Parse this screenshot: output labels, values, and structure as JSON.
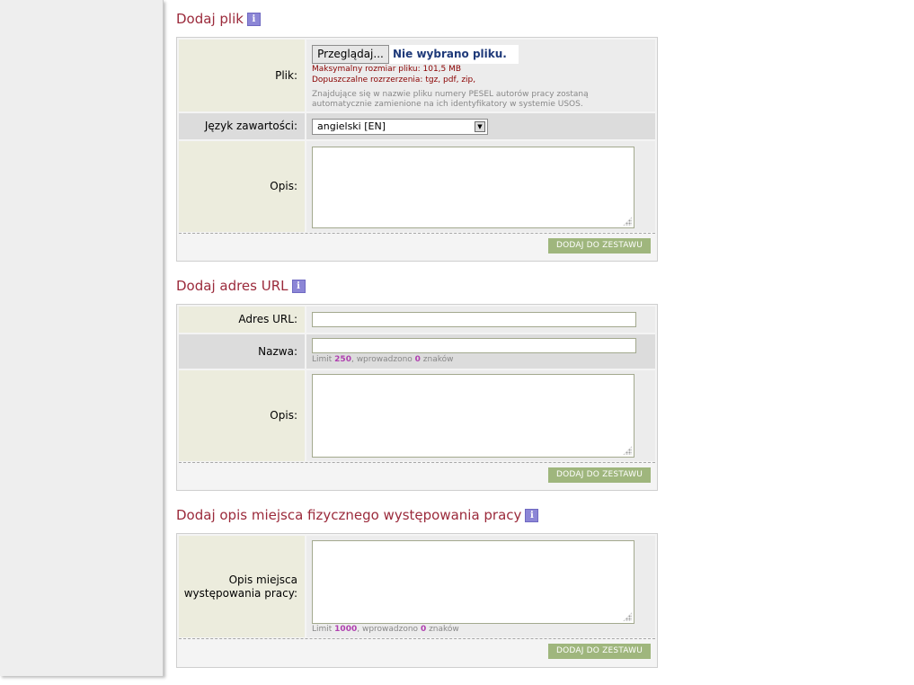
{
  "file_section": {
    "title": "Dodaj plik",
    "file_label": "Plik:",
    "browse_label": "Przeglądaj...",
    "no_file": "Nie wybrano pliku.",
    "max_size": "Maksymalny rozmiar pliku: 101,5 MB",
    "allowed_ext": "Dopuszczalne rozrzerzenia: tgz, pdf, zip,",
    "pesel_note": "Znajdujące się w nazwie pliku numery PESEL autorów pracy zostaną automatycznie zamienione na ich identyfikatory w systemie USOS.",
    "lang_label": "Język zawartości:",
    "lang_value": "angielski [EN]",
    "desc_label": "Opis:",
    "add_button": "DODAJ DO ZESTAWU"
  },
  "url_section": {
    "title": "Dodaj adres URL",
    "url_label": "Adres URL:",
    "name_label": "Nazwa:",
    "limit_prefix": "Limit ",
    "limit_value": "250",
    "entered_prefix": ", wprowadzono ",
    "entered_value": "0",
    "suffix": " znaków",
    "desc_label": "Opis:",
    "add_button": "DODAJ DO ZESTAWU"
  },
  "place_section": {
    "title": "Dodaj opis miejsca fizycznego występowania pracy",
    "desc_label": "Opis miejsca występowania pracy:",
    "limit_prefix": "Limit ",
    "limit_value": "1000",
    "entered_prefix": ", wprowadzono ",
    "entered_value": "0",
    "suffix": " znaków",
    "add_button": "DODAJ DO ZESTAWU"
  },
  "info_icon_glyph": "i",
  "colors": {
    "title": "#9b2a3b",
    "button": "#9fb67d",
    "label_bg": "#ececdd",
    "limit_highlight": "#b040b0"
  }
}
